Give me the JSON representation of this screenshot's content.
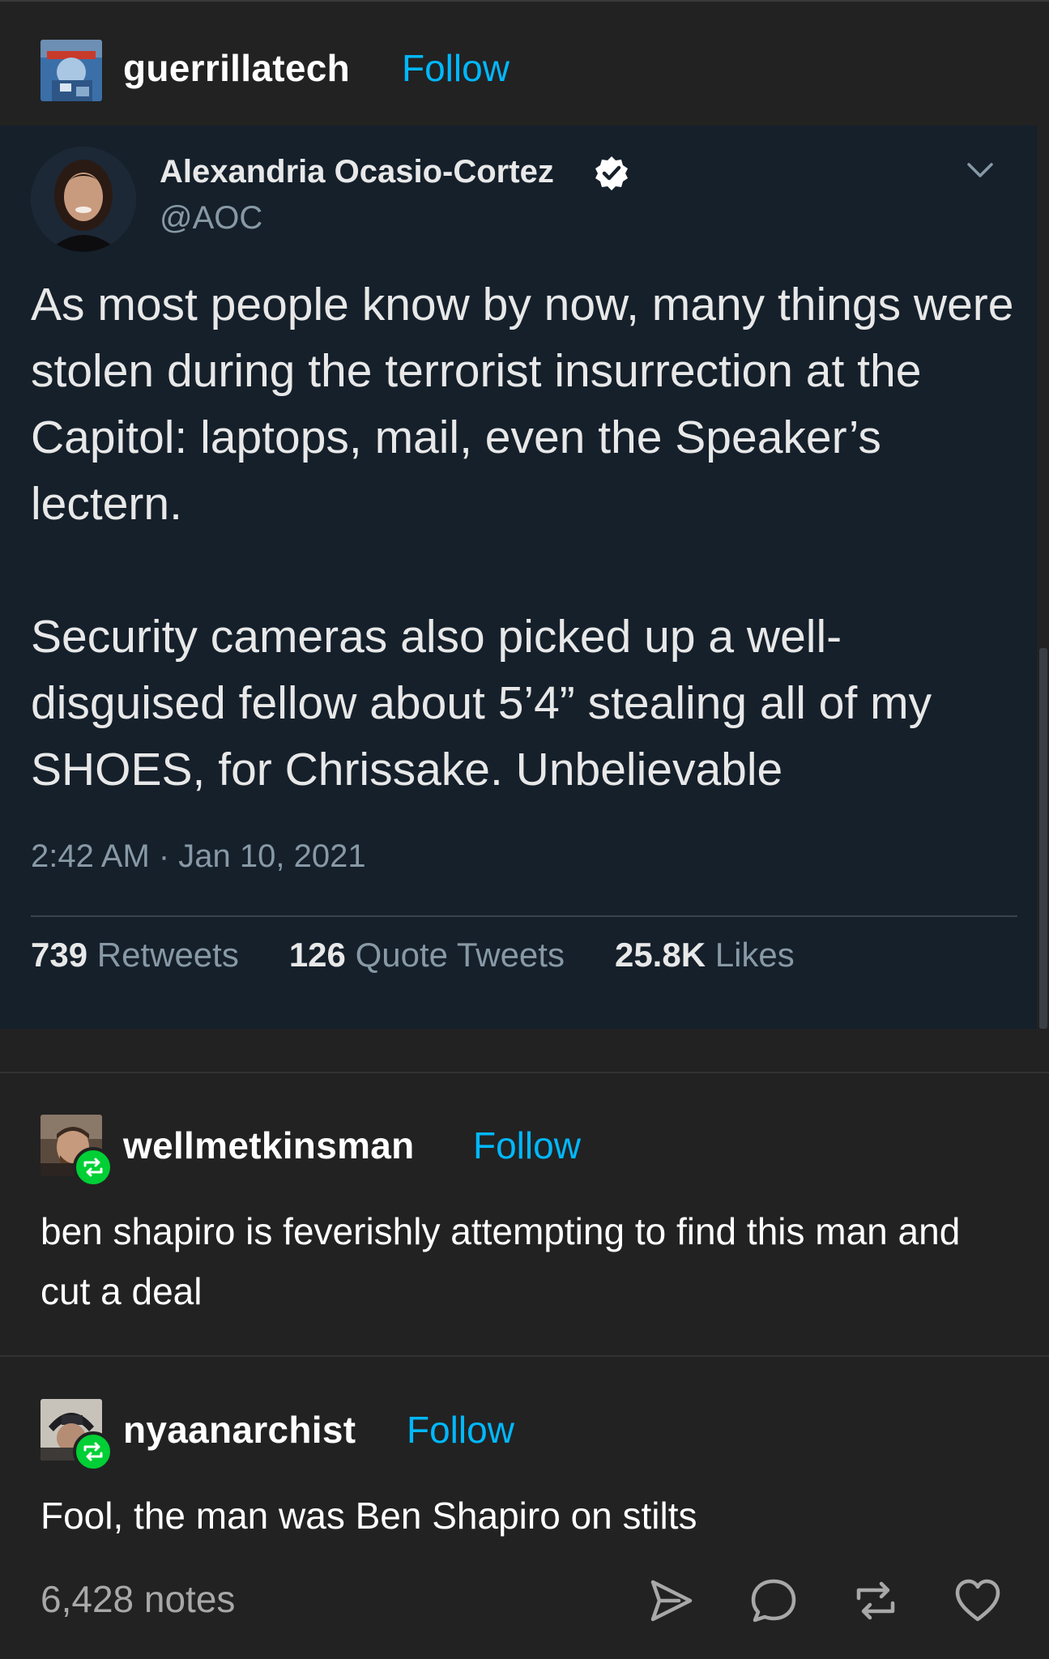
{
  "post": {
    "username": "guerrillatech",
    "follow_label": "Follow"
  },
  "tweet": {
    "author_name": "Alexandria Ocasio-Cortez",
    "handle": "@AOC",
    "paragraph1": "As most people know by now, many things were stolen during the terrorist insurrection at the Capitol: laptops, mail, even the Speaker’s lectern.",
    "paragraph2": "Security cameras also picked up a well-disguised fellow about 5’4” stealing all of my SHOES, for Chrissake. Unbelievable",
    "timestamp": "2:42 AM · Jan 10, 2021",
    "retweets_count": "739",
    "retweets_label": "Retweets",
    "quote_count": "126",
    "quote_label": "Quote Tweets",
    "likes_count": "25.8K",
    "likes_label": "Likes"
  },
  "reblogs": [
    {
      "username": "wellmetkinsman",
      "follow_label": "Follow",
      "text": "ben shapiro is feverishly attempting to find this man and cut a deal"
    },
    {
      "username": "nyaanarchist",
      "follow_label": "Follow",
      "text": "Fool, the man was Ben Shapiro on stilts"
    }
  ],
  "footer": {
    "notes": "6,428 notes"
  },
  "colors": {
    "accent": "#00b8ff",
    "reblog_green": "#00cf35",
    "tweet_bg": "#15202b",
    "page_bg": "#222222"
  }
}
